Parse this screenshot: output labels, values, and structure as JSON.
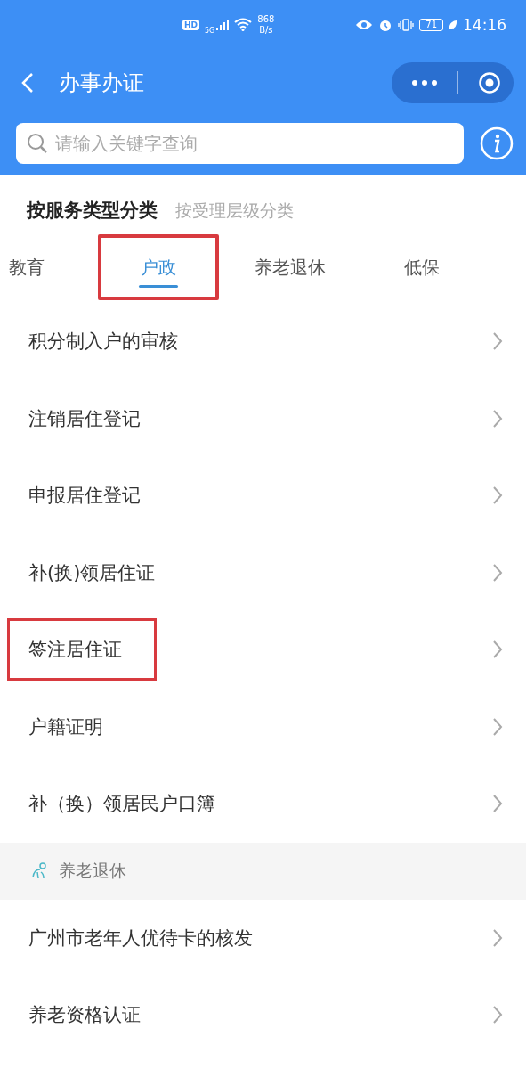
{
  "status_bar": {
    "hd": "HD",
    "network": "5G",
    "speed_value": "868",
    "speed_unit": "B/s",
    "battery": "71",
    "time": "14:16"
  },
  "header": {
    "title": "办事办证"
  },
  "search": {
    "placeholder": "请输入关键字查询"
  },
  "category_modes": [
    {
      "label": "按服务类型分类",
      "selected": true
    },
    {
      "label": "按受理层级分类",
      "selected": false
    }
  ],
  "tabs": [
    {
      "label": "教育",
      "selected": false,
      "highlighted": false
    },
    {
      "label": "户政",
      "selected": true,
      "highlighted": true
    },
    {
      "label": "养老退休",
      "selected": false,
      "highlighted": false
    },
    {
      "label": "低保",
      "selected": false,
      "highlighted": false
    }
  ],
  "sections": [
    {
      "items": [
        {
          "label": "积分制入户的审核",
          "highlighted": false
        },
        {
          "label": "注销居住登记",
          "highlighted": false
        },
        {
          "label": "申报居住登记",
          "highlighted": false
        },
        {
          "label": "补(换)领居住证",
          "highlighted": false
        },
        {
          "label": "签注居住证",
          "highlighted": true
        },
        {
          "label": "户籍证明",
          "highlighted": false
        },
        {
          "label": "补（换）领居民户口簿",
          "highlighted": false
        }
      ]
    },
    {
      "title": "养老退休",
      "items": [
        {
          "label": "广州市老年人优待卡的核发",
          "highlighted": false
        },
        {
          "label": "养老资格认证",
          "highlighted": false
        }
      ]
    }
  ]
}
